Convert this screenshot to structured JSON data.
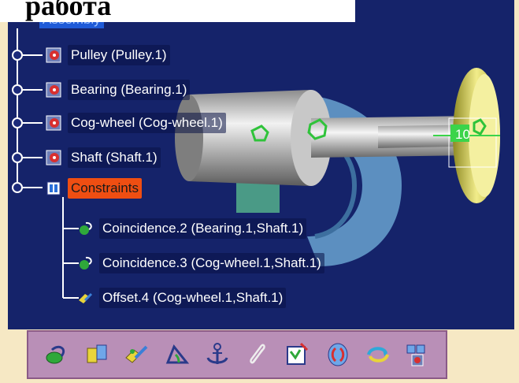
{
  "header": {
    "title": "работа"
  },
  "tree": {
    "root_label": "Assembly",
    "parts": [
      {
        "label": "Pulley (Pulley.1)",
        "icon": "part-icon"
      },
      {
        "label": "Bearing (Bearing.1)",
        "icon": "part-icon"
      },
      {
        "label": "Cog-wheel (Cog-wheel.1)",
        "icon": "part-icon"
      },
      {
        "label": "Shaft (Shaft.1)",
        "icon": "part-icon"
      }
    ],
    "constraints_label": "Constraints",
    "constraints": [
      {
        "label": "Coincidence.2 (Bearing.1,Shaft.1)",
        "icon": "coincidence-icon"
      },
      {
        "label": "Coincidence.3 (Cog-wheel.1,Shaft.1)",
        "icon": "coincidence-icon"
      },
      {
        "label": "Offset.4 (Cog-wheel.1,Shaft.1)",
        "icon": "offset-icon"
      }
    ]
  },
  "scene": {
    "offset_value": "10"
  },
  "toolbar": {
    "buttons": [
      "coincidence-icon",
      "contact-icon",
      "offset-icon",
      "angle-icon",
      "fix-icon",
      "fix-together-icon",
      "quick-constraint-icon",
      "flexible-rigid-icon",
      "change-constraint-icon",
      "reuse-pattern-icon"
    ]
  },
  "colors": {
    "viewport_bg": "#15236a",
    "constraints_highlight": "#ef4e12",
    "root_highlight": "#1f5bd8",
    "toolbar_bg": "#b98fb7"
  }
}
